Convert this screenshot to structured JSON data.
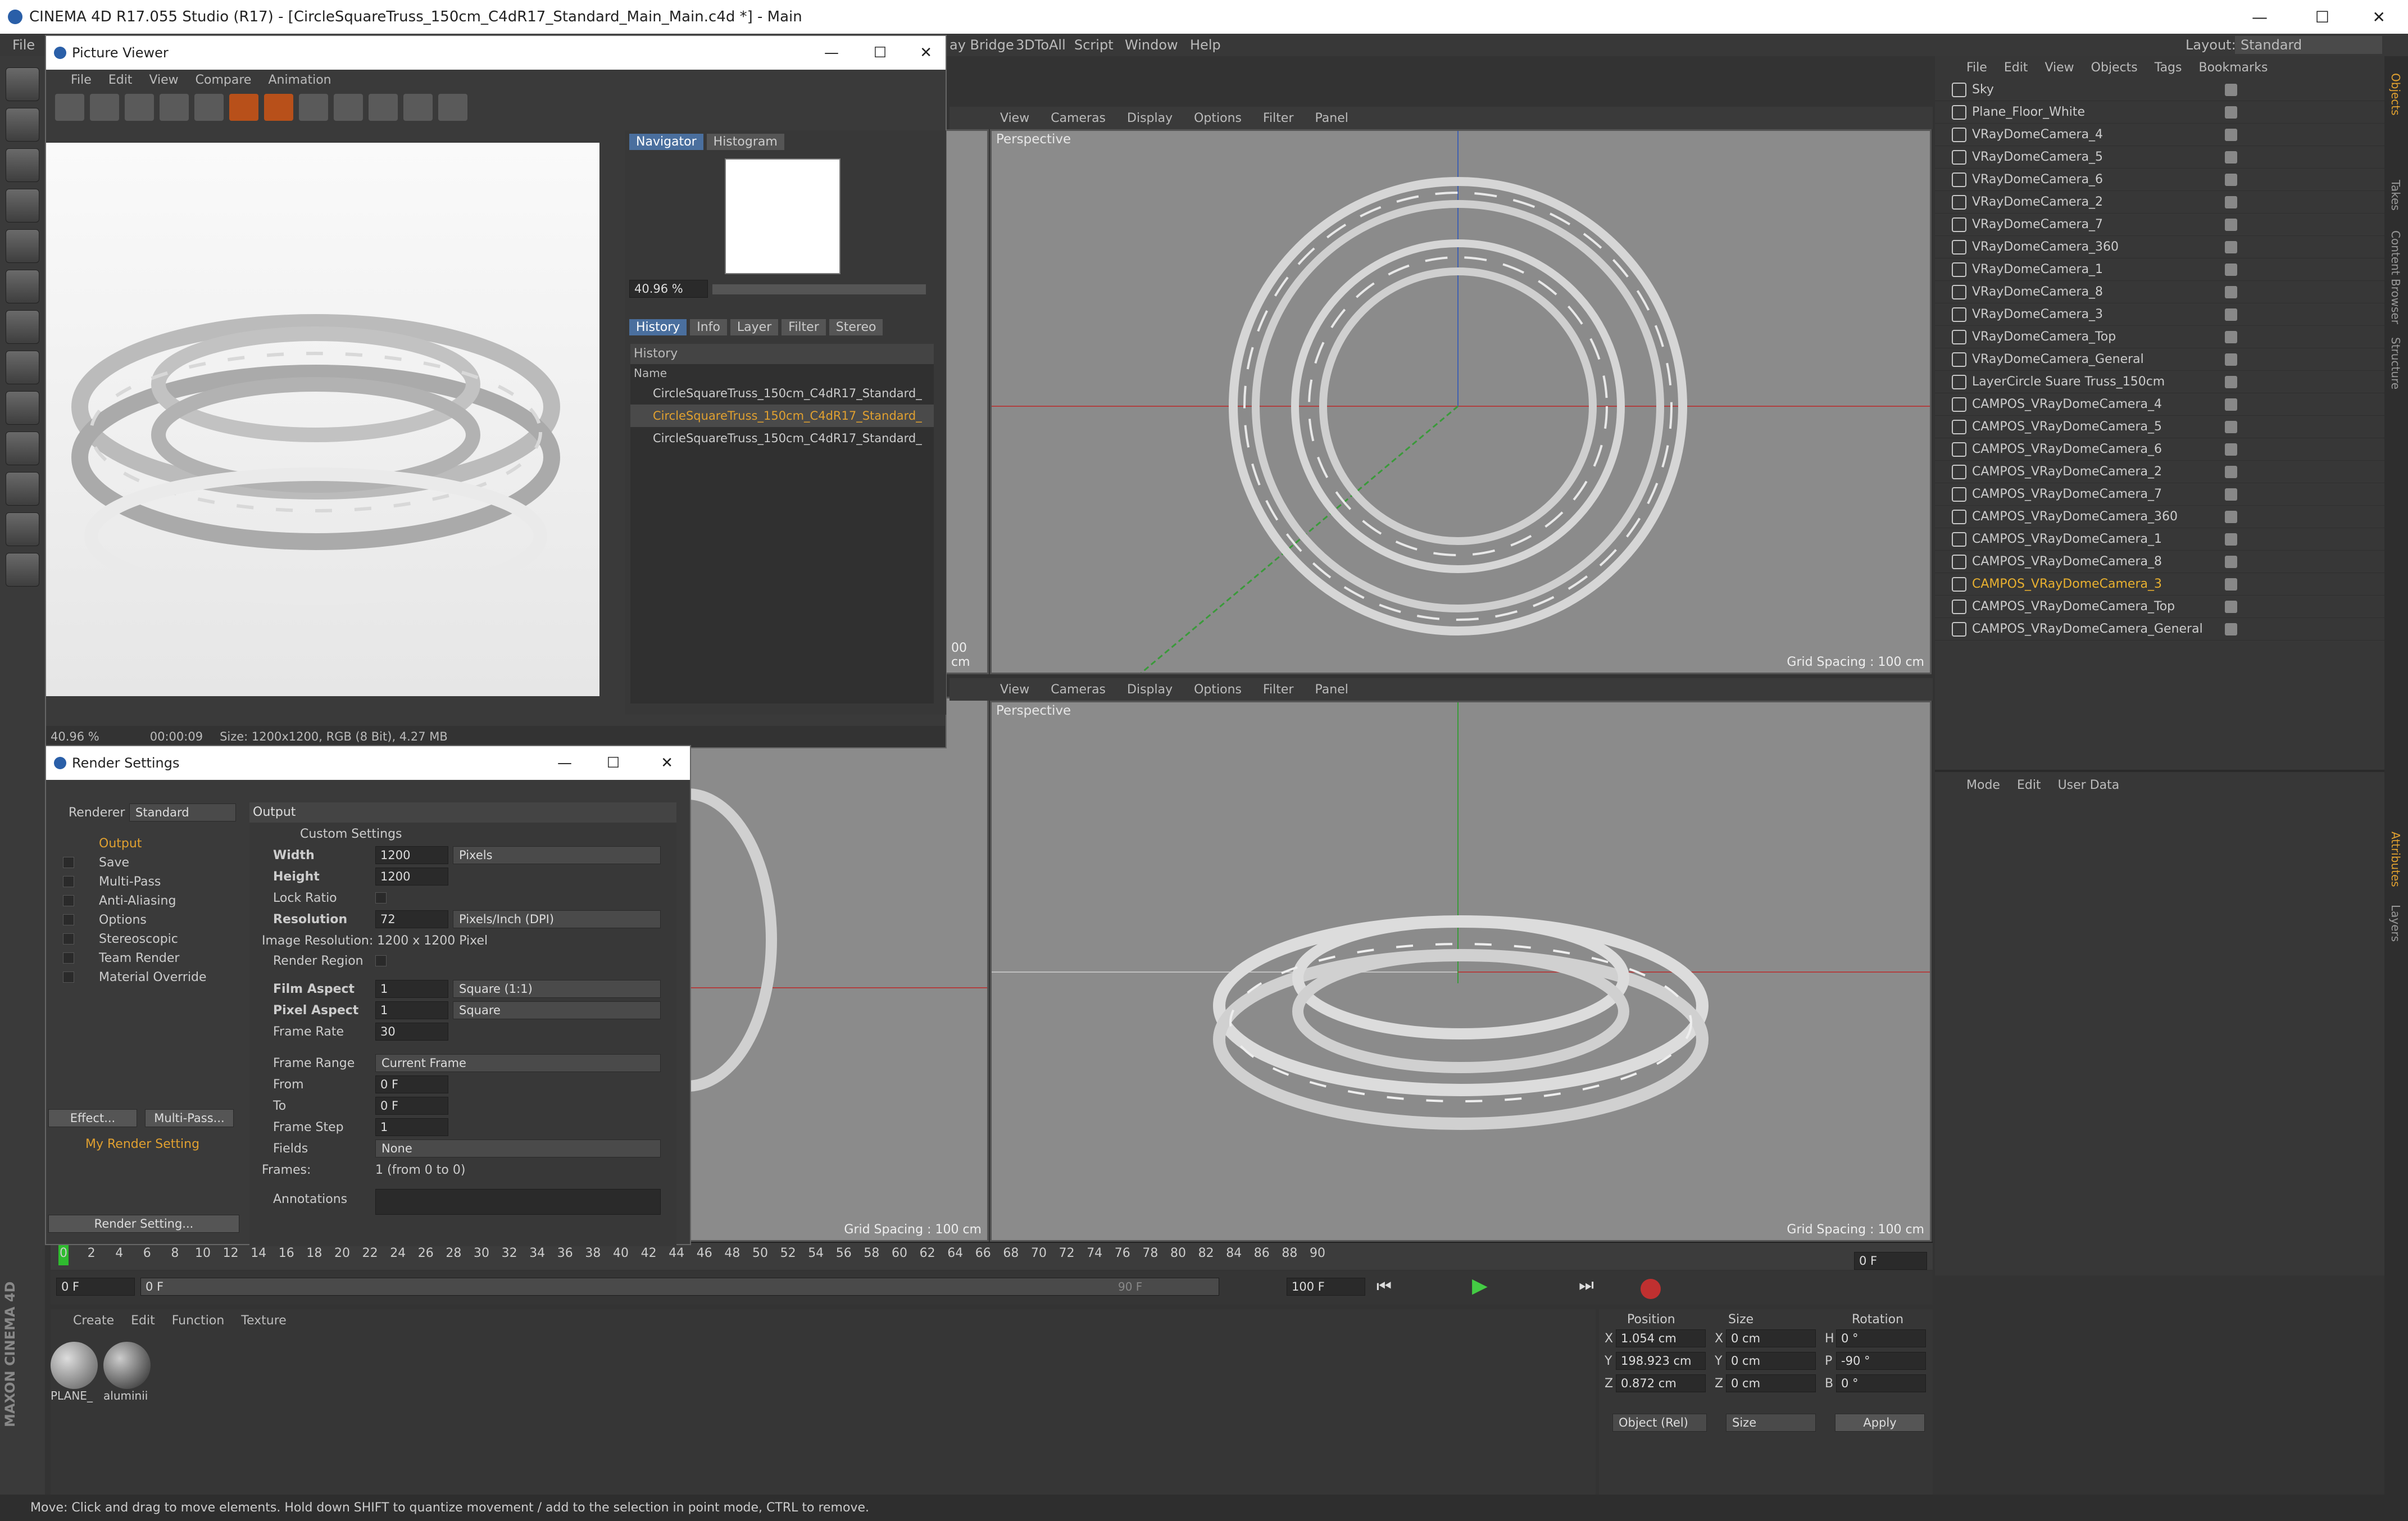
{
  "app": {
    "title": "CINEMA 4D R17.055 Studio (R17) - [CircleSquareTruss_150cm_C4dR17_Standard_Main_Main.c4d *] - Main",
    "menu": [
      "File",
      "ay Bridge",
      "3DToAll",
      "Script",
      "Window",
      "Help"
    ],
    "layout_label": "Layout:",
    "layout_value": "Standard",
    "win_min": "—",
    "win_max": "☐",
    "win_close": "✕"
  },
  "picture_viewer": {
    "title": "Picture Viewer",
    "menu": [
      "File",
      "Edit",
      "View",
      "Compare",
      "Animation"
    ],
    "tabs": [
      "Navigator",
      "Histogram"
    ],
    "zoom": "40.96 %",
    "tabs2": [
      "History",
      "Info",
      "Layer",
      "Filter",
      "Stereo"
    ],
    "history_header": "History",
    "name_col": "Name",
    "history": [
      "CircleSquareTruss_150cm_C4dR17_Standard_",
      "CircleSquareTruss_150cm_C4dR17_Standard_",
      "CircleSquareTruss_150cm_C4dR17_Standard_"
    ],
    "status_zoom": "40.96 %",
    "status_time": "00:00:09",
    "status_size": "Size: 1200x1200, RGB (8 Bit), 4.27 MB"
  },
  "render_settings": {
    "title": "Render Settings",
    "renderer_label": "Renderer",
    "renderer": "Standard",
    "tree": [
      "Output",
      "Save",
      "Multi-Pass",
      "Anti-Aliasing",
      "Options",
      "Stereoscopic",
      "Team Render",
      "Material Override"
    ],
    "effect_btn": "Effect...",
    "multipass_btn": "Multi-Pass...",
    "my_setting": "My Render Setting",
    "render_setting_btn": "Render Setting...",
    "section": "Output",
    "custom": "Custom Settings",
    "width_label": "Width",
    "width": "1200",
    "width_unit": "Pixels",
    "height_label": "Height",
    "height": "1200",
    "lock_label": "Lock Ratio",
    "res_label": "Resolution",
    "res": "72",
    "res_unit": "Pixels/Inch (DPI)",
    "img_res": "Image Resolution: 1200 x 1200 Pixel",
    "region_label": "Render Region",
    "film_label": "Film Aspect",
    "film": "1",
    "film_unit": "Square (1:1)",
    "pixel_label": "Pixel Aspect",
    "pixel": "1",
    "pixel_unit": "Square",
    "fps_label": "Frame Rate",
    "fps": "30",
    "range_label": "Frame Range",
    "range": "Current Frame",
    "from_label": "From",
    "from": "0 F",
    "to_label": "To",
    "to": "0 F",
    "step_label": "Frame Step",
    "step": "1",
    "fields_label": "Fields",
    "fields": "None",
    "frames_label": "Frames:",
    "frames": "1 (from 0 to 0)",
    "ann_label": "Annotations"
  },
  "viewports": {
    "menu": [
      "View",
      "Cameras",
      "Display",
      "Options",
      "Filter",
      "Panel"
    ],
    "persp": "Perspective",
    "grid": "Grid Spacing : 100 cm",
    "cm": "00 cm"
  },
  "objects": {
    "menu": [
      "File",
      "Edit",
      "View",
      "Objects",
      "Tags",
      "Bookmarks"
    ],
    "items": [
      "Sky",
      "Plane_Floor_White",
      "VRayDomeCamera_4",
      "VRayDomeCamera_5",
      "VRayDomeCamera_6",
      "VRayDomeCamera_2",
      "VRayDomeCamera_7",
      "VRayDomeCamera_360",
      "VRayDomeCamera_1",
      "VRayDomeCamera_8",
      "VRayDomeCamera_3",
      "VRayDomeCamera_Top",
      "VRayDomeCamera_General",
      "LayerCircle Suare Truss_150cm",
      "CAMPOS_VRayDomeCamera_4",
      "CAMPOS_VRayDomeCamera_5",
      "CAMPOS_VRayDomeCamera_6",
      "CAMPOS_VRayDomeCamera_2",
      "CAMPOS_VRayDomeCamera_7",
      "CAMPOS_VRayDomeCamera_360",
      "CAMPOS_VRayDomeCamera_1",
      "CAMPOS_VRayDomeCamera_8",
      "CAMPOS_VRayDomeCamera_3",
      "CAMPOS_VRayDomeCamera_Top",
      "CAMPOS_VRayDomeCamera_General"
    ],
    "selected_index": 22
  },
  "attributes": {
    "menu": [
      "Mode",
      "Edit",
      "User Data"
    ]
  },
  "side_tabs": [
    "Objects",
    "Takes",
    "Content Browser",
    "Structure"
  ],
  "side_tabs2": [
    "Attributes",
    "Layers"
  ],
  "timeline": {
    "ticks": [
      "0",
      "2",
      "4",
      "6",
      "8",
      "10",
      "12",
      "14",
      "16",
      "18",
      "20",
      "22",
      "24",
      "26",
      "28",
      "30",
      "32",
      "34",
      "36",
      "38",
      "40",
      "42",
      "44",
      "46",
      "48",
      "50",
      "52",
      "54",
      "56",
      "58",
      "60",
      "62",
      "64",
      "66",
      "68",
      "70",
      "72",
      "74",
      "76",
      "78",
      "80",
      "82",
      "84",
      "86",
      "88",
      "90"
    ],
    "current": "0 F",
    "start": "0 F",
    "range_start": "0 F",
    "range_end": "90 F",
    "end": "100 F"
  },
  "materials": {
    "menu": [
      "Create",
      "Edit",
      "Function",
      "Texture"
    ],
    "items": [
      "PLANE_",
      "aluminii"
    ]
  },
  "coords": {
    "headers": [
      "Position",
      "Size",
      "Rotation"
    ],
    "pos": [
      {
        "axis": "X",
        "val": "1.054 cm"
      },
      {
        "axis": "Y",
        "val": "198.923 cm"
      },
      {
        "axis": "Z",
        "val": "0.872 cm"
      }
    ],
    "size": [
      {
        "axis": "X",
        "val": "0 cm"
      },
      {
        "axis": "Y",
        "val": "0 cm"
      },
      {
        "axis": "Z",
        "val": "0 cm"
      }
    ],
    "rot": [
      {
        "axis": "H",
        "val": "0 °"
      },
      {
        "axis": "P",
        "val": "-90 °"
      },
      {
        "axis": "B",
        "val": "0 °"
      }
    ],
    "mode1": "Object (Rel)",
    "mode2": "Size",
    "apply": "Apply"
  },
  "status": "Move: Click and drag to move elements. Hold down SHIFT to quantize movement / add to the selection in point mode, CTRL to remove.",
  "brand": "MAXON CINEMA 4D"
}
